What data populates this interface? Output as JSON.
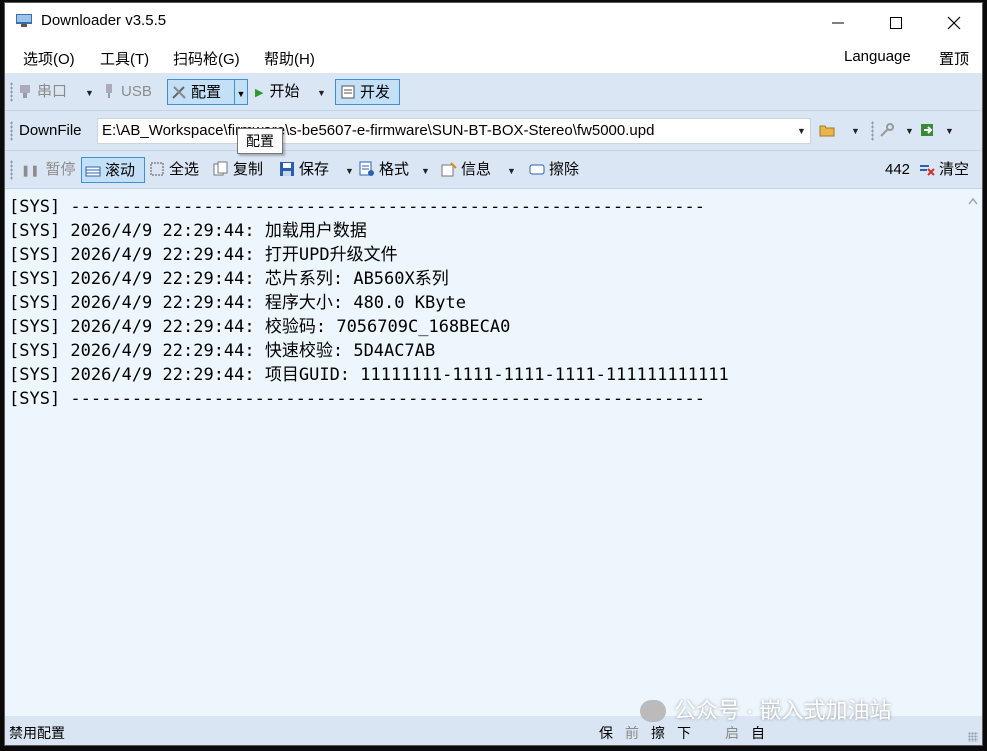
{
  "window": {
    "title": "Downloader v3.5.5"
  },
  "menu": {
    "items": [
      "选项(O)",
      "工具(T)",
      "扫码枪(G)",
      "帮助(H)"
    ],
    "language": "Language",
    "pin": "置顶"
  },
  "toolbar1": {
    "serial": "串口",
    "usb": "USB",
    "config": "配置",
    "start": "开始",
    "dev": "开发"
  },
  "toolbar2": {
    "downfile_label": "DownFile",
    "path": "E:\\AB_Workspace\\firmware\\s-be5607-e-firmware\\SUN-BT-BOX-Stereo\\fw5000.upd",
    "tooltip": "配置"
  },
  "toolbar3": {
    "pause": "暂停",
    "scroll": "滚动",
    "select_all": "全选",
    "copy": "复制",
    "save": "保存",
    "format": "格式",
    "info": "信息",
    "erase": "擦除",
    "count": "442",
    "clear": "清空"
  },
  "log": {
    "lines": [
      "[SYS] --------------------------------------------------------------",
      "[SYS] 2026/4/9 22:29:44: 加载用户数据",
      "[SYS] 2026/4/9 22:29:44: 打开UPD升级文件",
      "[SYS] 2026/4/9 22:29:44: 芯片系列: AB560X系列",
      "[SYS] 2026/4/9 22:29:44: 程序大小: 480.0 KByte",
      "[SYS] 2026/4/9 22:29:44: 校验码: 7056709C_168BECA0",
      "[SYS] 2026/4/9 22:29:44: 快速校验: 5D4AC7AB",
      "[SYS] 2026/4/9 22:29:44: 项目GUID: 11111111-1111-1111-1111-111111111111",
      "[SYS] --------------------------------------------------------------"
    ]
  },
  "status": {
    "left": "禁用配置",
    "right_items": [
      "保",
      "前",
      "擦",
      "下",
      "启",
      "自"
    ]
  },
  "watermark": {
    "text": "公众号 · 嵌入式加油站"
  },
  "colors": {
    "toolbar_bg": "#dbe6f4",
    "log_bg": "#eef6fd",
    "pressed_border": "#3d8fd6",
    "pressed_bg": "#c4e0f7"
  }
}
